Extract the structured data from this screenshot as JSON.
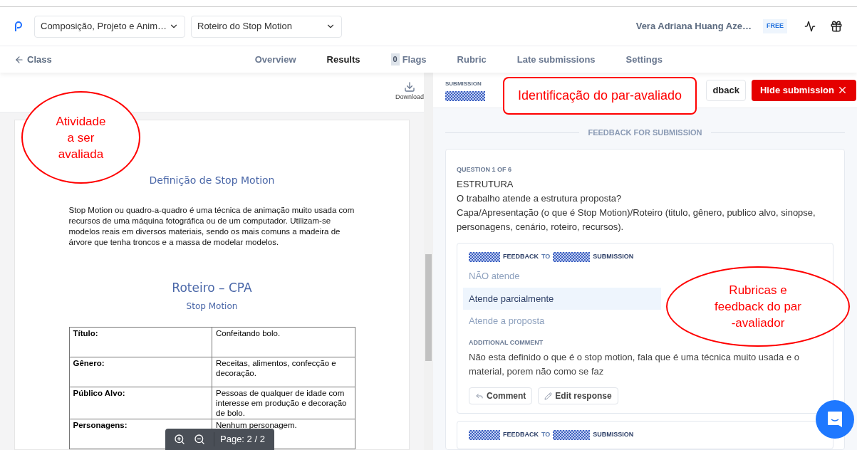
{
  "header": {
    "class_select": "Composição, Projeto e Anim…",
    "assignment_select": "Roteiro do Stop Motion",
    "user_name": "Vera Adriana Huang Aze…",
    "plan_badge": "FREE"
  },
  "nav": {
    "back": "Class",
    "tabs": [
      {
        "label": "Overview",
        "selected": false
      },
      {
        "label": "Results",
        "selected": true
      },
      {
        "label": "Flags",
        "selected": false,
        "count": "0"
      },
      {
        "label": "Rubric",
        "selected": false
      },
      {
        "label": "Late submissions",
        "selected": false
      },
      {
        "label": "Settings",
        "selected": false
      }
    ]
  },
  "document": {
    "download": "Download",
    "heading": "Definição de Stop Motion",
    "paragraph": "Stop Motion ou quadro-a-quadro é uma técnica de animação muito usada com recursos de uma máquina fotográfica ou de um computador. Utilizam-se modelos reais em diversos materiais, sendo os mais comuns a madeira de árvore que tenha troncos e a massa de modelar modelos.",
    "title": "Roteiro – CPA",
    "subtitle": "Stop Motion",
    "table": [
      {
        "label": "Título:",
        "value": "Confeitando bolo."
      },
      {
        "label": "Gênero:",
        "value": "Receitas, alimentos, confecção e decoração."
      },
      {
        "label": "Público Alvo:",
        "value": "Pessoas de qualquer de idade com interesse em produção e decoração de bolo."
      },
      {
        "label": "Personagens:",
        "value": "Nenhum personagem."
      }
    ],
    "page": "Page: 2 / 2"
  },
  "submission": {
    "label": "SUBMISSION",
    "feedback_button": "dback",
    "hide_button": "Hide submission",
    "section_title": "FEEDBACK FOR SUBMISSION",
    "question": {
      "number": "QUESTION 1 OF 6",
      "title": "ESTRUTURA",
      "prompt": "O trabalho atende a estrutura proposta?",
      "detail": "Capa/Apresentação (o que é Stop Motion)/Roteiro (titulo, gênero, publico alvo, sinopse, personagens, cenário, roteiro, recursos)."
    },
    "feedbacks": [
      {
        "label_a": "FEEDBACK",
        "label_to": "TO",
        "label_b": "SUBMISSION",
        "options": [
          {
            "label": "NÃO atende",
            "selected": false
          },
          {
            "label": "Atende parcialmente",
            "selected": true
          },
          {
            "label": "Atende a proposta",
            "selected": false
          }
        ],
        "comment_label": "ADDITIONAL COMMENT",
        "comment": "Não esta definido o que é o stop motion, fala que é uma técnica muito usada e o material, porem não como se faz",
        "actions": [
          "Comment",
          "Edit response"
        ]
      },
      {
        "label_a": "FEEDBACK",
        "label_to": "TO",
        "label_b": "SUBMISSION"
      }
    ]
  },
  "annotations": [
    {
      "kind": "ellipse",
      "lines": [
        "Atividade",
        "a ser",
        "avaliada"
      ]
    },
    {
      "kind": "box",
      "lines": [
        "Identificação do par-avaliado"
      ]
    },
    {
      "kind": "ellipse",
      "lines": [
        "Rubricas e",
        "feedback do par",
        "-avaliador"
      ]
    }
  ]
}
